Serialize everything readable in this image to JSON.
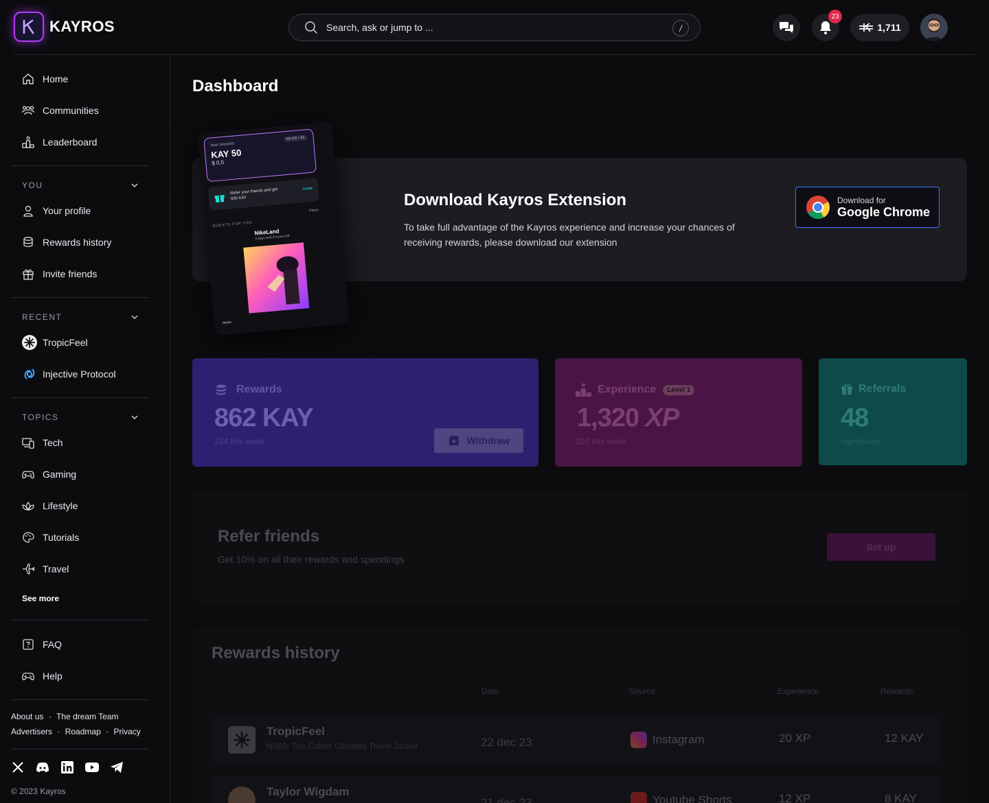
{
  "brand": {
    "name": "KAYROS"
  },
  "search": {
    "placeholder": "Search, ask or jump to ...",
    "shortcut": "/"
  },
  "header": {
    "notification_count": "23",
    "balance": "1,711"
  },
  "sidebar": {
    "main": [
      {
        "label": "Home",
        "icon": "home-icon"
      },
      {
        "label": "Communities",
        "icon": "communities-icon"
      },
      {
        "label": "Leaderboard",
        "icon": "leaderboard-icon"
      }
    ],
    "you_label": "YOU",
    "you": [
      {
        "label": "Your profile",
        "icon": "user-icon"
      },
      {
        "label": "Rewards history",
        "icon": "coins-icon"
      },
      {
        "label": "Invite friends",
        "icon": "gift-icon"
      }
    ],
    "recent_label": "RECENT",
    "recent": [
      {
        "label": "TropicFeel",
        "icon": "tropicfeel-icon"
      },
      {
        "label": "Injective Protocol",
        "icon": "injective-icon"
      }
    ],
    "topics_label": "TOPICS",
    "topics": [
      {
        "label": "Tech",
        "icon": "tech-icon"
      },
      {
        "label": "Gaming",
        "icon": "gamepad-icon"
      },
      {
        "label": "Lifestyle",
        "icon": "lotus-icon"
      },
      {
        "label": "Tutorials",
        "icon": "palette-icon"
      },
      {
        "label": "Travel",
        "icon": "plane-icon"
      }
    ],
    "see_more": "See more",
    "support": [
      {
        "label": "FAQ",
        "icon": "question-icon"
      },
      {
        "label": "Help",
        "icon": "gamepad-icon"
      }
    ],
    "footer_line1": [
      "About us",
      "The dream Team"
    ],
    "footer_line2": [
      "Advertisers",
      "Roadmap",
      "Privacy"
    ],
    "copyright": "© 2023 Kayros"
  },
  "page": {
    "title": "Dashboard"
  },
  "extension": {
    "title": "Download  Kayros Extension",
    "description": "To take full advantage of the Kayros experience and increase your chances of receiving rewards, please download our extension",
    "button_small": "Download for",
    "button_big": "Google Chrome",
    "phone": {
      "your_rewards": "Your rewards",
      "rate": "K$ 100 = $1",
      "kay": "KAY 50",
      "usd": "$ 0,5",
      "refer_text": "Refer your friends and get 500 KAY",
      "invite": "Invite",
      "filters": "Filters",
      "quests_label": "QUESTS FOR YOU",
      "quest_name": "NikeLand",
      "quest_time": "3 days and 8 hours left",
      "home": "Home"
    }
  },
  "stats": {
    "rewards": {
      "label": "Rewards",
      "value": "862 KAY",
      "sub": "234 this week",
      "button": "Withdraw"
    },
    "experience": {
      "label": "Experience",
      "level": "Level 1",
      "value_num": "1,320",
      "value_unit": "XP",
      "sub": "310 this week"
    },
    "referrals": {
      "label": "Referrals",
      "value": "48",
      "sub": "signed-ups"
    }
  },
  "refer": {
    "title": "Refer friends",
    "subtitle": "Get 10% on all their rewards and spendings",
    "button": "Set up"
  },
  "history": {
    "title": "Rewards history",
    "columns": [
      "Date",
      "Source",
      "Experience",
      "Rewards"
    ],
    "rows": [
      {
        "title": "TropicFeel",
        "subtitle": "NS60: The Colder Climates Travel Jacket",
        "date": "22 dec 23",
        "source": "Instagram",
        "xp": "20 XP",
        "kay": "12 KAY"
      },
      {
        "title": "Taylor Wigdam",
        "subtitle": "",
        "date": "21 dec 23",
        "source": "Youtube Shorts",
        "xp": "12 XP",
        "kay": "8 KAY"
      }
    ]
  },
  "colors": {
    "rewards_card": "#2e2070",
    "experience_card": "#4a1545",
    "referrals_card": "#0f4a4a",
    "accent_blue": "#3d7bff"
  }
}
